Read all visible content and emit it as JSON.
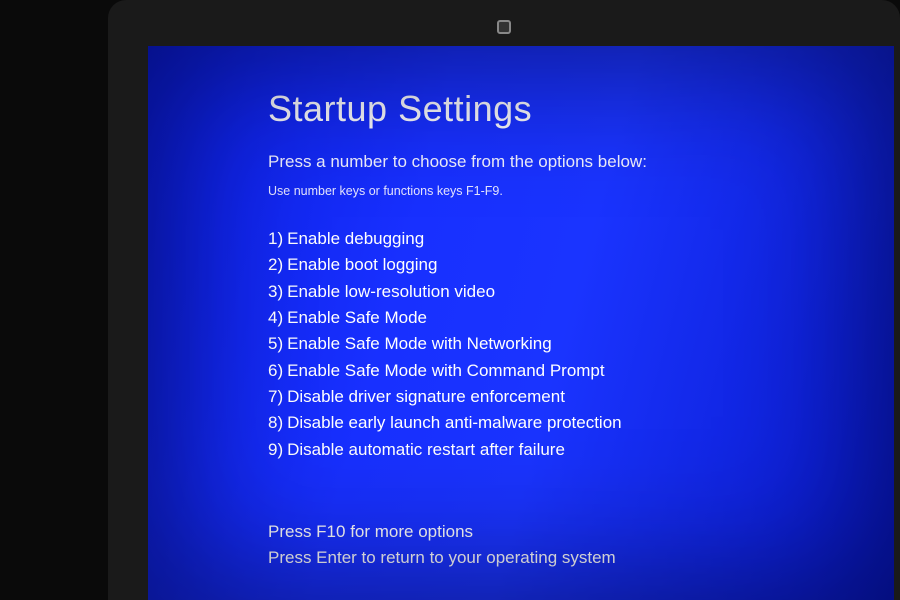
{
  "colors": {
    "screen_bg_from": "#0b1de0",
    "screen_bg_to": "#0818c8",
    "text": "#ffffff"
  },
  "screen": {
    "title": "Startup Settings",
    "subtitle": "Press a number to choose from the options below:",
    "hint": "Use number keys or functions keys F1-F9.",
    "options": [
      {
        "num": "1)",
        "label": "Enable debugging"
      },
      {
        "num": "2)",
        "label": "Enable boot logging"
      },
      {
        "num": "3)",
        "label": "Enable low-resolution video"
      },
      {
        "num": "4)",
        "label": "Enable Safe Mode"
      },
      {
        "num": "5)",
        "label": "Enable Safe Mode with Networking"
      },
      {
        "num": "6)",
        "label": "Enable Safe Mode with Command Prompt"
      },
      {
        "num": "7)",
        "label": "Disable driver signature enforcement"
      },
      {
        "num": "8)",
        "label": "Disable early launch anti-malware protection"
      },
      {
        "num": "9)",
        "label": "Disable automatic restart after failure"
      }
    ],
    "footer_more": "Press F10 for more options",
    "footer_return": "Press Enter to return to your operating system"
  }
}
